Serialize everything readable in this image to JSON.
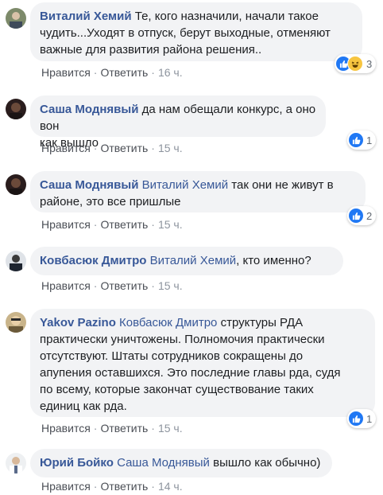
{
  "comments": [
    {
      "author": "Виталий Хемий",
      "mention": "",
      "text_lines": [
        "Те, кого назначили, начали такое",
        "чудить...Уходят в отпуск, берут выходные, отменяют",
        "важные для развития района решения.."
      ],
      "like_label": "Нравится",
      "reply_label": "Ответить",
      "time": "16 ч.",
      "reaction_count": "3",
      "reaction_icons": [
        "like-icon",
        "haha-icon"
      ]
    },
    {
      "author": "Саша Моднявый",
      "mention": "",
      "text_lines": [
        "да нам обещали конкурс, а оно вон",
        "как вышло"
      ],
      "like_label": "Нравится",
      "reply_label": "Ответить",
      "time": "15 ч.",
      "reaction_count": "1",
      "reaction_icons": [
        "like-icon"
      ]
    },
    {
      "author": "Саша Моднявый",
      "mention": "Виталий Хемий",
      "text_lines": [
        "так они не живут в",
        "районе, это все пришлые"
      ],
      "like_label": "Нравится",
      "reply_label": "Ответить",
      "time": "15 ч.",
      "reaction_count": "2",
      "reaction_icons": [
        "like-icon"
      ]
    },
    {
      "author": "Ковбасюк Дмитро",
      "mention": "Виталий Хемий",
      "text_lines": [
        ", кто именно?"
      ],
      "like_label": "Нравится",
      "reply_label": "Ответить",
      "time": "15 ч.",
      "reaction_count": "",
      "reaction_icons": []
    },
    {
      "author": "Yakov Pazino",
      "mention": "Ковбасюк Дмитро",
      "text_lines": [
        "структуры РДА",
        "практически уничтожены. Полномочия практически",
        "отсутствуют. Штаты сотрудников сокращены до",
        "апупения оставшихся. Это последние главы рда, судя",
        "по всему, которые закончат существование таких",
        "единиц как рда."
      ],
      "like_label": "Нравится",
      "reply_label": "Ответить",
      "time": "15 ч.",
      "reaction_count": "1",
      "reaction_icons": [
        "like-icon"
      ]
    },
    {
      "author": "Юрий Бойко",
      "mention": "Саша Моднявый",
      "text_lines": [
        "вышло как обычно)"
      ],
      "like_label": "Нравится",
      "reply_label": "Ответить",
      "time": "14 ч.",
      "reaction_count": "",
      "reaction_icons": []
    }
  ],
  "colors": {
    "author": "#385898",
    "bubble": "#f2f3f5",
    "like": "#2078f4",
    "haha": "#f7c540",
    "meta": "#8d949e"
  }
}
